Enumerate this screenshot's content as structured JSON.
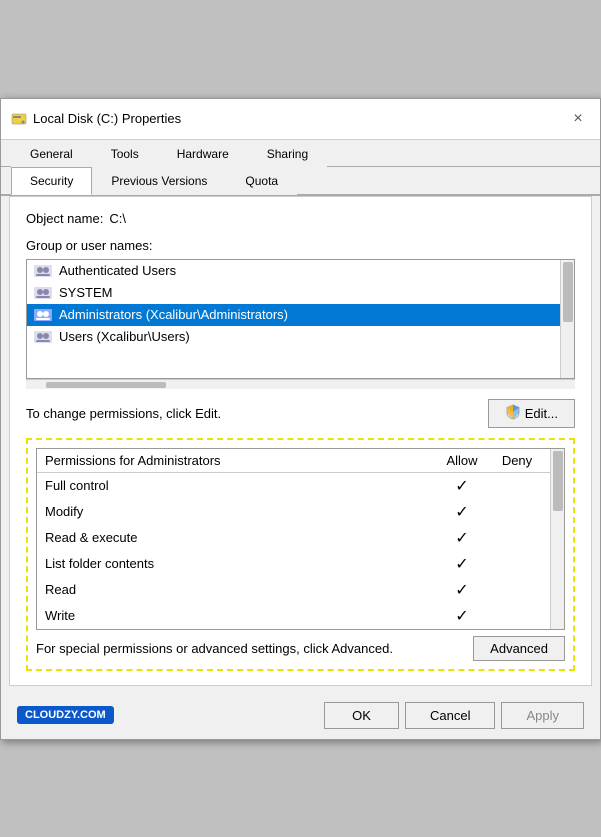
{
  "window": {
    "title": "Local Disk (C:) Properties",
    "close_label": "×"
  },
  "tabs": {
    "row1": [
      {
        "label": "General",
        "active": false
      },
      {
        "label": "Tools",
        "active": false
      },
      {
        "label": "Hardware",
        "active": false
      },
      {
        "label": "Sharing",
        "active": false
      }
    ],
    "row2": [
      {
        "label": "Security",
        "active": true
      },
      {
        "label": "Previous Versions",
        "active": false
      },
      {
        "label": "Quota",
        "active": false
      }
    ]
  },
  "object_name_label": "Object name:",
  "object_name_value": "C:\\",
  "group_label": "Group or user names:",
  "users": [
    {
      "name": "Authenticated Users",
      "selected": false
    },
    {
      "name": "SYSTEM",
      "selected": false
    },
    {
      "name": "Administrators (Xcalibur\\Administrators)",
      "selected": true
    },
    {
      "name": "Users (Xcalibur\\Users)",
      "selected": false
    }
  ],
  "change_permissions_text": "To change permissions, click Edit.",
  "edit_button_label": "Edit...",
  "permissions_header": {
    "name_col": "Permissions for Administrators",
    "allow_col": "Allow",
    "deny_col": "Deny"
  },
  "permissions": [
    {
      "name": "Full control",
      "allow": true,
      "deny": false
    },
    {
      "name": "Modify",
      "allow": true,
      "deny": false
    },
    {
      "name": "Read & execute",
      "allow": true,
      "deny": false
    },
    {
      "name": "List folder contents",
      "allow": true,
      "deny": false
    },
    {
      "name": "Read",
      "allow": true,
      "deny": false
    },
    {
      "name": "Write",
      "allow": true,
      "deny": false
    }
  ],
  "advanced_text": "For special permissions or advanced settings, click Advanced.",
  "advanced_button_label": "Advanced",
  "footer": {
    "ok_label": "OK",
    "cancel_label": "Cancel",
    "apply_label": "Apply",
    "cloudzy_label": "CLOUDZY.COM"
  }
}
